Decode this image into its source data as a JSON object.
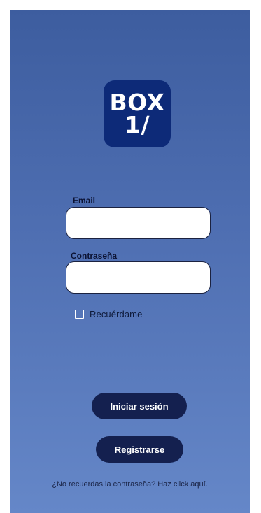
{
  "logo": {
    "line1": "BOX",
    "line2": "1/"
  },
  "form": {
    "email_label": "Email",
    "email_value": "",
    "password_label": "Contraseña",
    "password_value": "",
    "remember_label": "Recuérdame",
    "remember_checked": false
  },
  "actions": {
    "login_label": "Iniciar sesión",
    "register_label": "Registrarse",
    "forgot_text": "¿No recuerdas la contraseña? Haz click aquí."
  },
  "colors": {
    "background_top": "#3d5d9f",
    "background_bottom": "#6587c8",
    "logo_bg": "#0d2a78",
    "button_bg": "#14204f"
  }
}
